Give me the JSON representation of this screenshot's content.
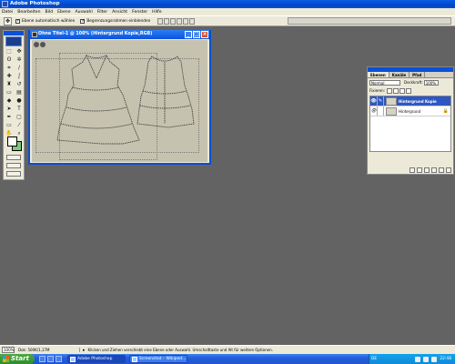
{
  "window": {
    "title": "Adobe Photoshop"
  },
  "menu": [
    "Datei",
    "Bearbeiten",
    "Bild",
    "Ebene",
    "Auswahl",
    "Filter",
    "Ansicht",
    "Fenster",
    "Hilfe"
  ],
  "options": {
    "auto_select_label": "Ebene automatisch wählen",
    "bounding_box_label": "Begrenzungsrahmen einblenden"
  },
  "document": {
    "title": "Ohne Titel-1 @ 100% (Hintergrund Kopie,RGB)"
  },
  "layers_panel": {
    "tabs": [
      "Ebenen",
      "Kanäle",
      "Pfad"
    ],
    "blend_mode": "Normal",
    "opacity_label": "Deckkraft:",
    "opacity_value": "100%",
    "lock_label": "Fixieren:",
    "layers": [
      {
        "name": "Hintergrund Kopie",
        "active": true
      },
      {
        "name": "Hintergrund",
        "active": false
      }
    ]
  },
  "status": {
    "zoom": "100%",
    "doc_size": "Dok: 500K/1,17M",
    "hint": "Klicken und Ziehen verschiebt eine Ebene oder Auswahl. Umschalttaste und Alt für weitere Optionen."
  },
  "taskbar": {
    "start": "Start",
    "tasks": [
      {
        "label": "Adobe Photoshop",
        "active": true
      },
      {
        "label": "Screenshot – Wikiped...",
        "active": false
      }
    ],
    "lang": "DE",
    "clock": "22:48"
  },
  "colors": {
    "accent": "#0a50d8",
    "foreground": "#ffffff",
    "background_swatch": "#7dc87a"
  }
}
